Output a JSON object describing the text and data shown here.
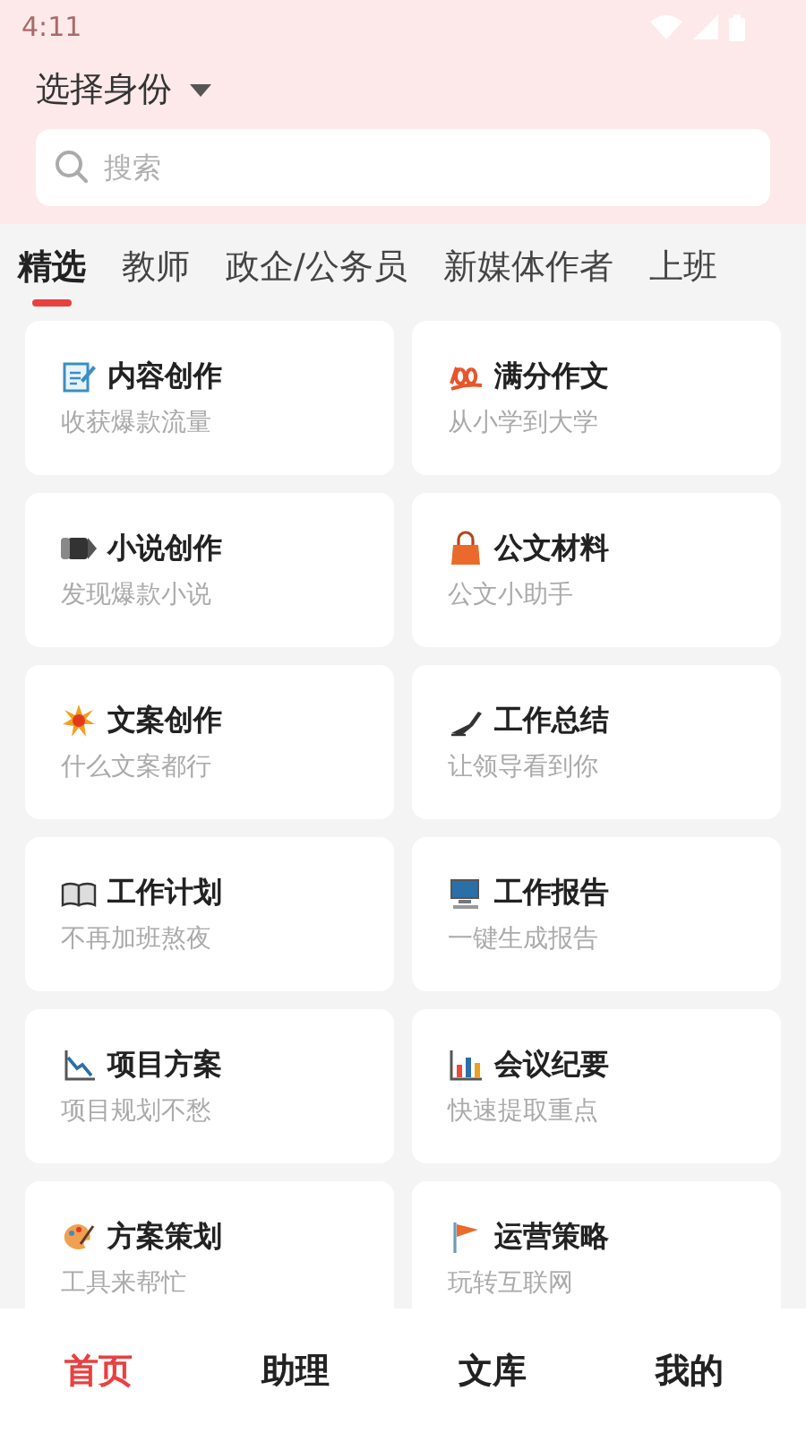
{
  "status_bar": {
    "time": "4:11"
  },
  "header": {
    "title": "选择身份"
  },
  "search": {
    "placeholder": "搜索"
  },
  "tabs": [
    {
      "label": "精选",
      "selected": true
    },
    {
      "label": "教师",
      "selected": false
    },
    {
      "label": "政企/公务员",
      "selected": false
    },
    {
      "label": "新媒体作者",
      "selected": false
    },
    {
      "label": "上班",
      "selected": false
    }
  ],
  "cards": [
    {
      "title": "内容创作",
      "subtitle": "收获爆款流量"
    },
    {
      "title": "满分作文",
      "subtitle": "从小学到大学"
    },
    {
      "title": "小说创作",
      "subtitle": "发现爆款小说"
    },
    {
      "title": "公文材料",
      "subtitle": "公文小助手"
    },
    {
      "title": "文案创作",
      "subtitle": "什么文案都行"
    },
    {
      "title": "工作总结",
      "subtitle": "让领导看到你"
    },
    {
      "title": "工作计划",
      "subtitle": "不再加班熬夜"
    },
    {
      "title": "工作报告",
      "subtitle": "一键生成报告"
    },
    {
      "title": "项目方案",
      "subtitle": "项目规划不愁"
    },
    {
      "title": "会议纪要",
      "subtitle": "快速提取重点"
    },
    {
      "title": "方案策划",
      "subtitle": "工具来帮忙"
    },
    {
      "title": "运营策略",
      "subtitle": "玩转互联网"
    }
  ],
  "bottom_nav": [
    {
      "label": "首页",
      "selected": true
    },
    {
      "label": "助理",
      "selected": false
    },
    {
      "label": "文库",
      "selected": false
    },
    {
      "label": "我的",
      "selected": false
    }
  ]
}
